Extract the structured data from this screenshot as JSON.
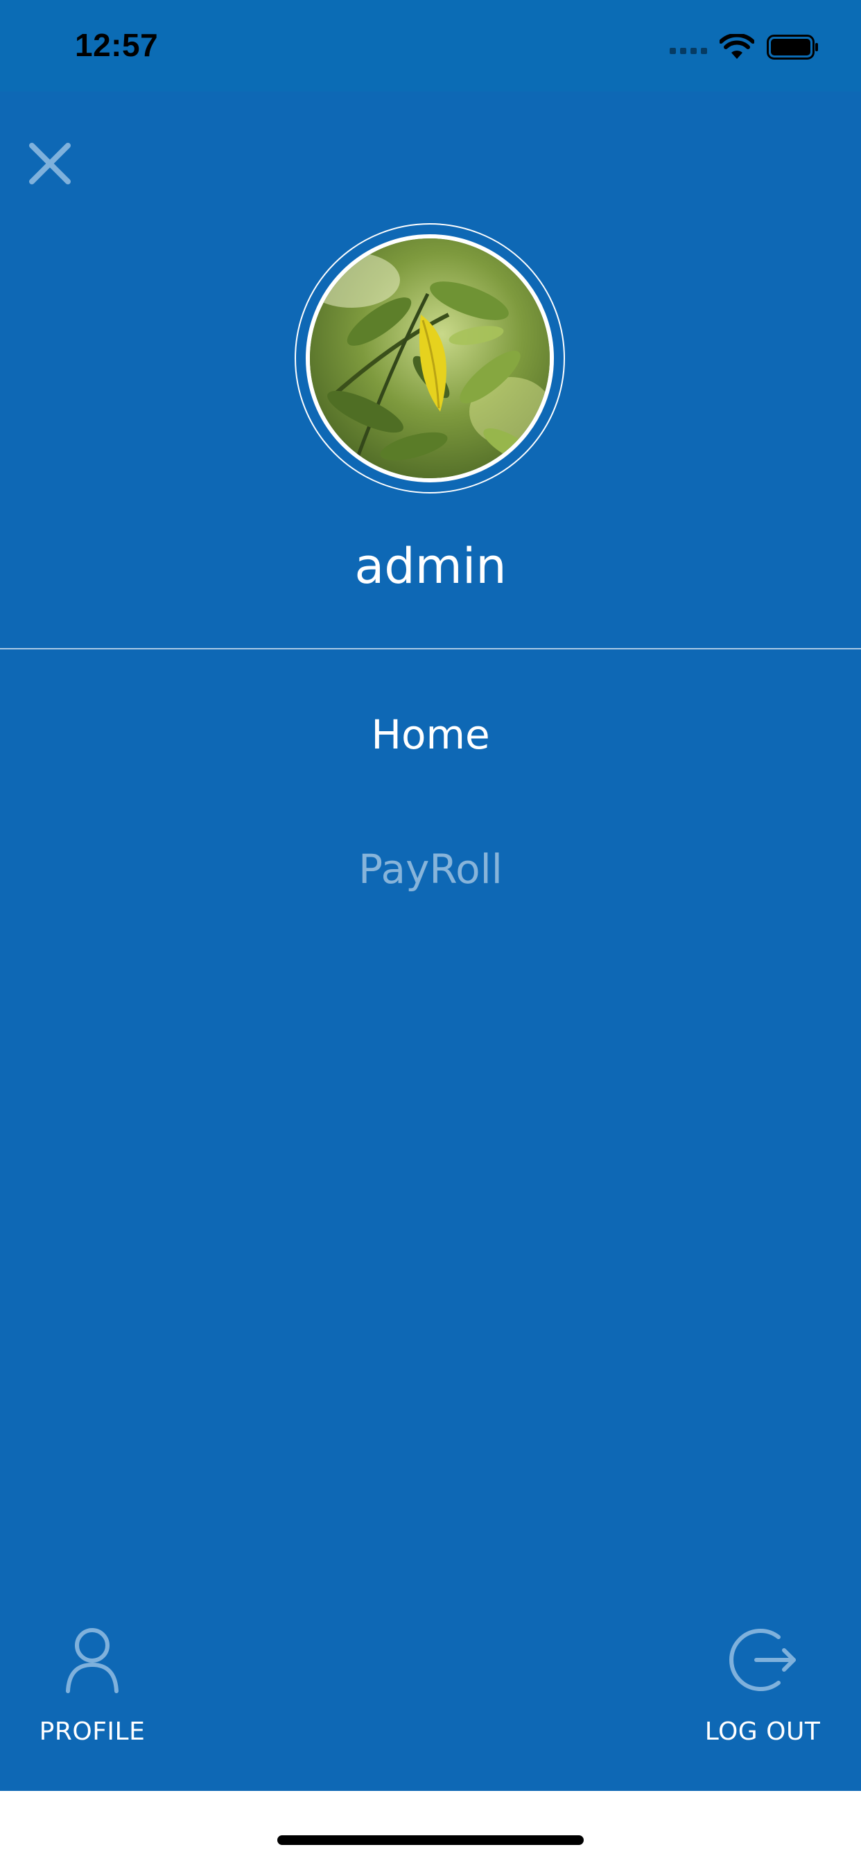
{
  "status_bar": {
    "time": "12:57"
  },
  "drawer": {
    "username": "admin",
    "menu": [
      {
        "label": "Home",
        "active": true
      },
      {
        "label": "PayRoll",
        "active": false
      }
    ],
    "profile_label": "PROFILE",
    "logout_label": "LOG OUT"
  },
  "icons": {
    "close": "close-icon",
    "profile": "user-icon",
    "logout": "logout-icon",
    "wifi": "wifi-icon",
    "battery": "battery-icon",
    "signal": "signal-icon"
  },
  "colors": {
    "background": "#0E68B5",
    "status_bar": "#0B6CB5",
    "text_primary": "#FFFFFF",
    "text_muted": "#80B0DA",
    "icon_muted": "#7FB1DC"
  }
}
